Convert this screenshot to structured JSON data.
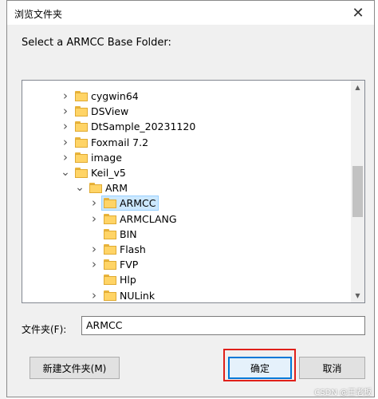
{
  "window": {
    "title": "浏览文件夹",
    "close_icon": "close-icon"
  },
  "prompt": "Select a ARMCC Base Folder:",
  "tree": {
    "items": [
      {
        "label": "cygwin64",
        "expandable": true,
        "expanded": false,
        "selected": false
      },
      {
        "label": "DSView",
        "expandable": true,
        "expanded": false,
        "selected": false
      },
      {
        "label": "DtSample_20231120",
        "expandable": true,
        "expanded": false,
        "selected": false
      },
      {
        "label": "Foxmail 7.2",
        "expandable": true,
        "expanded": false,
        "selected": false
      },
      {
        "label": "image",
        "expandable": true,
        "expanded": false,
        "selected": false
      },
      {
        "label": "Keil_v5",
        "expandable": true,
        "expanded": true,
        "selected": false
      },
      {
        "label": "ARM",
        "expandable": true,
        "expanded": true,
        "selected": false
      },
      {
        "label": "ARMCC",
        "expandable": true,
        "expanded": false,
        "selected": true
      },
      {
        "label": "ARMCLANG",
        "expandable": true,
        "expanded": false,
        "selected": false
      },
      {
        "label": "BIN",
        "expandable": false,
        "expanded": false,
        "selected": false
      },
      {
        "label": "Flash",
        "expandable": true,
        "expanded": false,
        "selected": false
      },
      {
        "label": "FVP",
        "expandable": true,
        "expanded": false,
        "selected": false
      },
      {
        "label": "Hlp",
        "expandable": false,
        "expanded": false,
        "selected": false
      },
      {
        "label": "NULink",
        "expandable": true,
        "expanded": false,
        "selected": false
      }
    ]
  },
  "folder_field": {
    "label": "文件夹(F):",
    "value": "ARMCC"
  },
  "buttons": {
    "new_folder": "新建文件夹(M)",
    "ok": "确定",
    "cancel": "取消"
  },
  "watermark": "CSDN @王老板",
  "colors": {
    "selection": "#cce8ff",
    "highlight_box": "#e0201a",
    "folder": "#ffd466"
  }
}
